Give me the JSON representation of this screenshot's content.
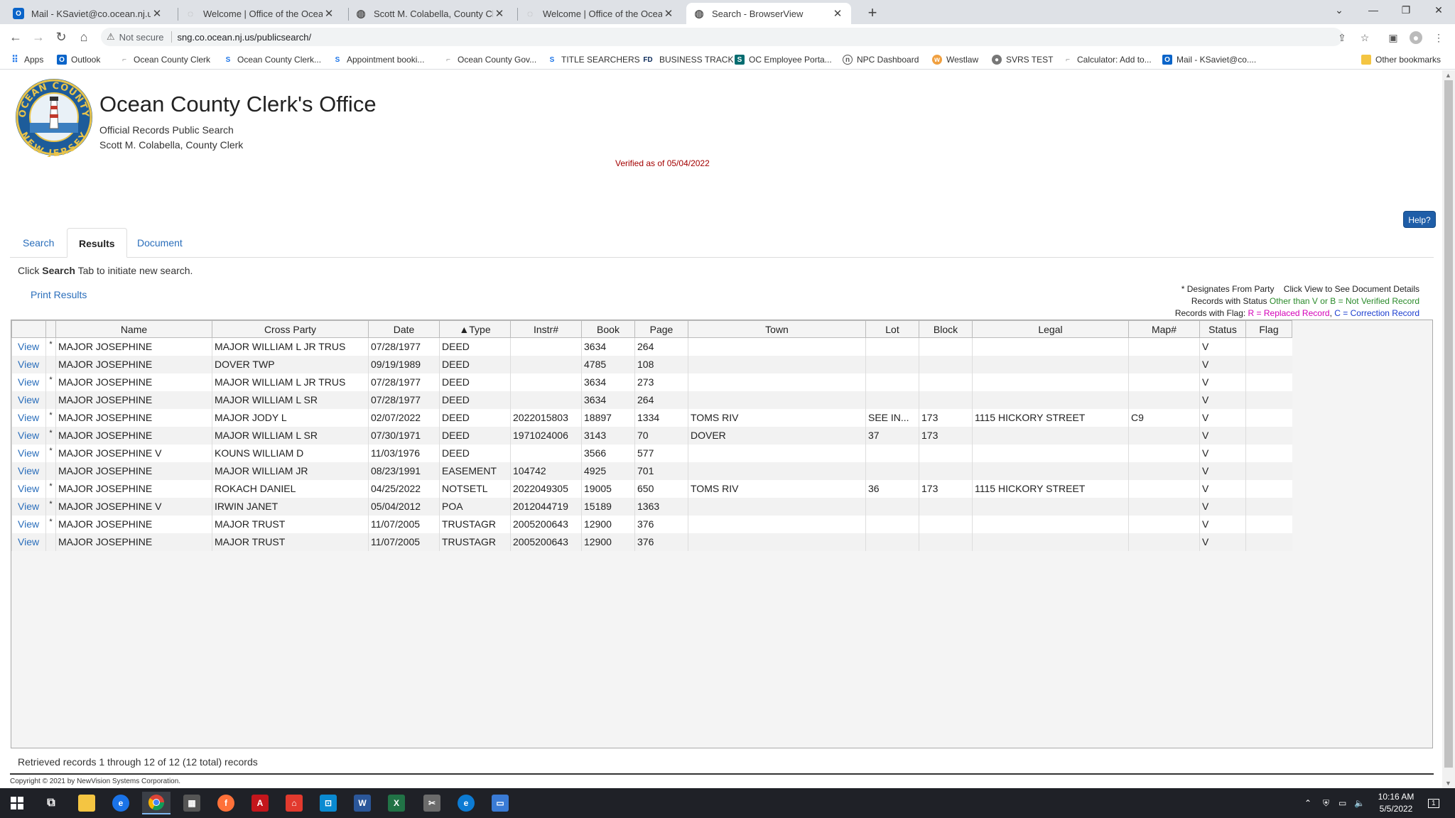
{
  "browser": {
    "tabs": [
      {
        "title": "Mail - KSaviet@co.ocean.nj.us",
        "icon": "outlook-icon",
        "active": false
      },
      {
        "title": "Welcome | Office of the Ocean C",
        "icon": "loading-icon",
        "active": false
      },
      {
        "title": "Scott M. Colabella, County Clerk",
        "icon": "globe-icon",
        "active": false
      },
      {
        "title": "Welcome | Office of the Ocean C",
        "icon": "loading-icon",
        "active": false
      },
      {
        "title": "Search - BrowserView",
        "icon": "globe-icon",
        "active": true
      }
    ],
    "not_secure": "Not secure",
    "url": "sng.co.ocean.nj.us/publicsearch/",
    "bookmarks": [
      {
        "label": "Apps",
        "icon": "apps-grid-icon"
      },
      {
        "label": "Outlook",
        "icon": "outlook-icon"
      },
      {
        "label": "Ocean County Clerk",
        "icon": "ocean-logo-icon"
      },
      {
        "label": "Ocean County Clerk...",
        "icon": "s-logo-icon"
      },
      {
        "label": "Appointment booki...",
        "icon": "s-logo-icon"
      },
      {
        "label": "Ocean County Gov...",
        "icon": "ocean-logo-icon"
      },
      {
        "label": "TITLE SEARCHERS",
        "icon": "s-logo-icon"
      },
      {
        "label": "BUSINESS TRACK",
        "icon": "fd-logo-icon"
      },
      {
        "label": "OC Employee Porta...",
        "icon": "sharepoint-icon"
      },
      {
        "label": "NPC Dashboard",
        "icon": "npc-icon"
      },
      {
        "label": "Westlaw",
        "icon": "westlaw-icon"
      },
      {
        "label": "SVRS TEST",
        "icon": "seal-icon"
      },
      {
        "label": "Calculator: Add to...",
        "icon": "calculator-icon"
      },
      {
        "label": "Mail - KSaviet@co....",
        "icon": "outlook-icon"
      }
    ],
    "other_bookmarks": "Other bookmarks"
  },
  "header": {
    "seal_text_top": "OCEAN COUNTY",
    "seal_text_bottom": "NEW JERSEY",
    "title": "Ocean County Clerk's Office",
    "subtitle1": "Official Records Public Search",
    "subtitle2": "Scott M. Colabella, County Clerk",
    "verified": "Verified as of 05/04/2022",
    "help": "Help?"
  },
  "tabs": [
    {
      "label": "Search",
      "active": false
    },
    {
      "label": "Results",
      "active": true
    },
    {
      "label": "Document",
      "active": false
    }
  ],
  "hint": {
    "pre": "Click ",
    "bold": "Search",
    "post": " Tab to initiate new search."
  },
  "print_results": "Print Results",
  "legend": {
    "line1": "* Designates From Party    Click View to See Document Details",
    "line2_pre": "Records with Status ",
    "line2_green": "Other than V or B = Not Verified Record",
    "line3_pre": "Records with Flag: ",
    "line3_pink": "R = Replaced Record",
    "line3_mid": ", ",
    "line3_blue": "C = Correction Record"
  },
  "table": {
    "columns": [
      "",
      "",
      "Name",
      "Cross Party",
      "Date",
      "▲Type",
      "Instr#",
      "Book",
      "Page",
      "Town",
      "Lot",
      "Block",
      "Legal",
      "Map#",
      "Status",
      "Flag"
    ],
    "view_label": "View",
    "rows": [
      {
        "star": "*",
        "name": "MAJOR JOSEPHINE",
        "cross": "MAJOR WILLIAM L JR TRUS",
        "date": "07/28/1977",
        "type": "DEED",
        "instr": "",
        "book": "3634",
        "page": "264",
        "town": "",
        "lot": "",
        "block": "",
        "legal": "",
        "map": "",
        "status": "V",
        "flag": ""
      },
      {
        "star": "",
        "name": "MAJOR JOSEPHINE",
        "cross": "DOVER TWP",
        "date": "09/19/1989",
        "type": "DEED",
        "instr": "",
        "book": "4785",
        "page": "108",
        "town": "",
        "lot": "",
        "block": "",
        "legal": "",
        "map": "",
        "status": "V",
        "flag": ""
      },
      {
        "star": "*",
        "name": "MAJOR JOSEPHINE",
        "cross": "MAJOR WILLIAM L JR TRUS",
        "date": "07/28/1977",
        "type": "DEED",
        "instr": "",
        "book": "3634",
        "page": "273",
        "town": "",
        "lot": "",
        "block": "",
        "legal": "",
        "map": "",
        "status": "V",
        "flag": ""
      },
      {
        "star": "",
        "name": "MAJOR JOSEPHINE",
        "cross": "MAJOR WILLIAM L SR",
        "date": "07/28/1977",
        "type": "DEED",
        "instr": "",
        "book": "3634",
        "page": "264",
        "town": "",
        "lot": "",
        "block": "",
        "legal": "",
        "map": "",
        "status": "V",
        "flag": ""
      },
      {
        "star": "*",
        "name": "MAJOR JOSEPHINE",
        "cross": "MAJOR JODY L",
        "date": "02/07/2022",
        "type": "DEED",
        "instr": "2022015803",
        "book": "18897",
        "page": "1334",
        "town": "TOMS RIV",
        "lot": "SEE IN...",
        "block": "173",
        "legal": "1115 HICKORY STREET",
        "map": "C9",
        "status": "V",
        "flag": ""
      },
      {
        "star": "*",
        "name": "MAJOR JOSEPHINE",
        "cross": "MAJOR WILLIAM L SR",
        "date": "07/30/1971",
        "type": "DEED",
        "instr": "1971024006",
        "book": "3143",
        "page": "70",
        "town": "DOVER",
        "lot": "37",
        "block": "173",
        "legal": "",
        "map": "",
        "status": "V",
        "flag": ""
      },
      {
        "star": "*",
        "name": "MAJOR JOSEPHINE V",
        "cross": "KOUNS WILLIAM D",
        "date": "11/03/1976",
        "type": "DEED",
        "instr": "",
        "book": "3566",
        "page": "577",
        "town": "",
        "lot": "",
        "block": "",
        "legal": "",
        "map": "",
        "status": "V",
        "flag": ""
      },
      {
        "star": "",
        "name": "MAJOR JOSEPHINE",
        "cross": "MAJOR WILLIAM JR",
        "date": "08/23/1991",
        "type": "EASEMENT",
        "instr": "104742",
        "book": "4925",
        "page": "701",
        "town": "",
        "lot": "",
        "block": "",
        "legal": "",
        "map": "",
        "status": "V",
        "flag": ""
      },
      {
        "star": "*",
        "name": "MAJOR JOSEPHINE",
        "cross": "ROKACH DANIEL",
        "date": "04/25/2022",
        "type": "NOTSETL",
        "instr": "2022049305",
        "book": "19005",
        "page": "650",
        "town": "TOMS RIV",
        "lot": "36",
        "block": "173",
        "legal": "1115 HICKORY STREET",
        "map": "",
        "status": "V",
        "flag": ""
      },
      {
        "star": "*",
        "name": "MAJOR JOSEPHINE V",
        "cross": "IRWIN JANET",
        "date": "05/04/2012",
        "type": "POA",
        "instr": "2012044719",
        "book": "15189",
        "page": "1363",
        "town": "",
        "lot": "",
        "block": "",
        "legal": "",
        "map": "",
        "status": "V",
        "flag": ""
      },
      {
        "star": "*",
        "name": "MAJOR JOSEPHINE",
        "cross": "MAJOR TRUST",
        "date": "11/07/2005",
        "type": "TRUSTAGR",
        "instr": "2005200643",
        "book": "12900",
        "page": "376",
        "town": "",
        "lot": "",
        "block": "",
        "legal": "",
        "map": "",
        "status": "V",
        "flag": ""
      },
      {
        "star": "",
        "name": "MAJOR JOSEPHINE",
        "cross": "MAJOR TRUST",
        "date": "11/07/2005",
        "type": "TRUSTAGR",
        "instr": "2005200643",
        "book": "12900",
        "page": "376",
        "town": "",
        "lot": "",
        "block": "",
        "legal": "",
        "map": "",
        "status": "V",
        "flag": ""
      }
    ]
  },
  "retrieved": "Retrieved records 1 through 12 of 12 (12 total) records",
  "copyright": "Copyright © 2021 by NewVision Systems Corporation.",
  "taskbar": {
    "time": "10:16 AM",
    "date": "5/5/2022",
    "notification_count": "1"
  }
}
